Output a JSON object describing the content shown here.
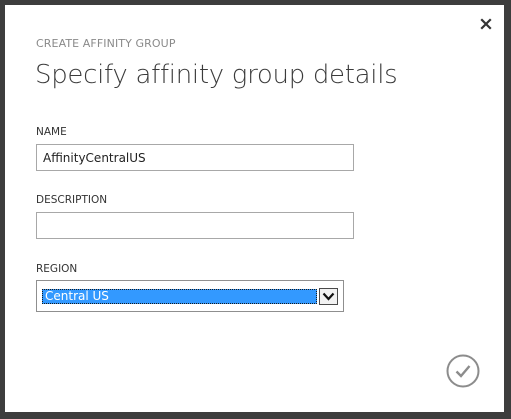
{
  "dialog": {
    "subtitle": "CREATE AFFINITY GROUP",
    "title": "Specify affinity group details"
  },
  "fields": {
    "name_label": "NAME",
    "name_value": "AffinityCentralUS",
    "description_label": "DESCRIPTION",
    "description_value": "",
    "region_label": "REGION",
    "region_value": "Central US"
  },
  "icons": {
    "close": "close-icon",
    "dropdown": "chevron-down-icon",
    "confirm": "checkmark-icon"
  },
  "colors": {
    "selection_highlight": "#3399ff",
    "frame": "#3d3d3d",
    "confirm_icon": "#8c8c8c"
  }
}
